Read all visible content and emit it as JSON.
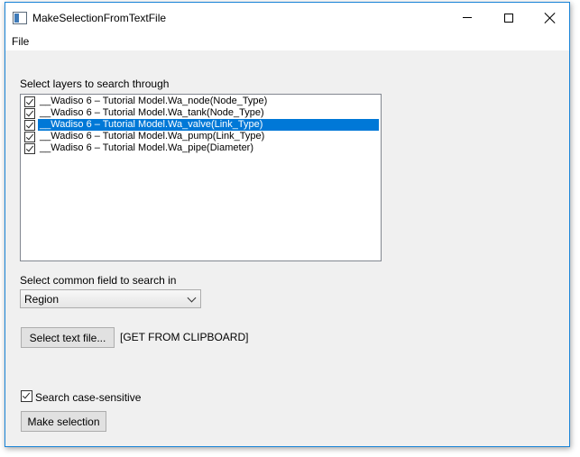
{
  "window": {
    "title": "MakeSelectionFromTextFile",
    "accent_color": "#1883d7"
  },
  "menu": {
    "file": "File"
  },
  "layers": {
    "label": "Select layers to search through",
    "items": [
      {
        "text": "__Wadiso 6 – Tutorial Model.Wa_node(Node_Type)",
        "checked": true,
        "selected": false
      },
      {
        "text": "__Wadiso 6 – Tutorial Model.Wa_tank(Node_Type)",
        "checked": true,
        "selected": false
      },
      {
        "text": "__Wadiso 6 – Tutorial Model.Wa_valve(Link_Type)",
        "checked": true,
        "selected": true
      },
      {
        "text": "__Wadiso 6 – Tutorial Model.Wa_pump(Link_Type)",
        "checked": true,
        "selected": false
      },
      {
        "text": "__Wadiso 6 – Tutorial Model.Wa_pipe(Diameter)",
        "checked": true,
        "selected": false
      }
    ],
    "selection_color": "#0078d7"
  },
  "field": {
    "label": "Select common field to search in",
    "value": "Region"
  },
  "textfile": {
    "button_label": "Select text file...",
    "source_label": "[GET FROM CLIPBOARD]"
  },
  "case_sensitive": {
    "label": "Search case-sensitive",
    "checked": true
  },
  "make_selection": {
    "button_label": "Make selection"
  }
}
